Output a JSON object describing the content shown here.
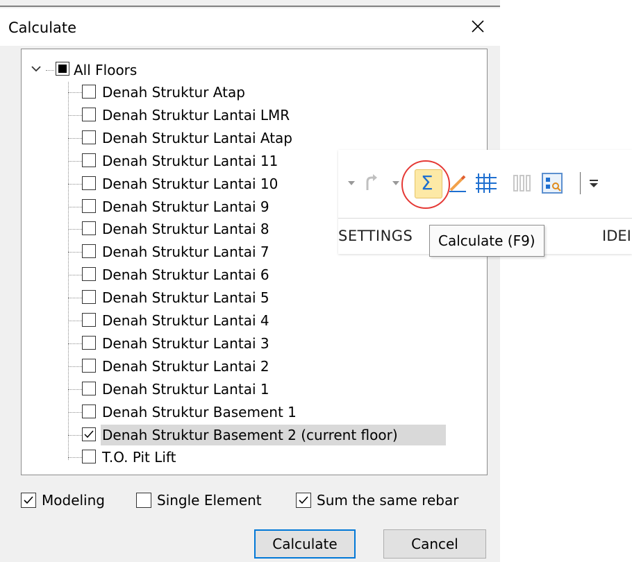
{
  "dialog": {
    "title": "Calculate",
    "close_icon": "close-icon"
  },
  "tree": {
    "root_label": "All Floors",
    "items": [
      {
        "label": "Denah Struktur Atap",
        "checked": false
      },
      {
        "label": "Denah Struktur Lantai LMR",
        "checked": false
      },
      {
        "label": "Denah Struktur Lantai Atap",
        "checked": false
      },
      {
        "label": "Denah Struktur Lantai 11",
        "checked": false
      },
      {
        "label": "Denah Struktur Lantai 10",
        "checked": false
      },
      {
        "label": "Denah Struktur Lantai 9",
        "checked": false
      },
      {
        "label": "Denah Struktur Lantai 8",
        "checked": false
      },
      {
        "label": "Denah Struktur Lantai 7",
        "checked": false
      },
      {
        "label": "Denah Struktur Lantai 6",
        "checked": false
      },
      {
        "label": "Denah Struktur Lantai 5",
        "checked": false
      },
      {
        "label": "Denah Struktur Lantai 4",
        "checked": false
      },
      {
        "label": "Denah Struktur Lantai 3",
        "checked": false
      },
      {
        "label": "Denah Struktur Lantai 2",
        "checked": false
      },
      {
        "label": "Denah Struktur Lantai 1",
        "checked": false
      },
      {
        "label": "Denah Struktur Basement 1",
        "checked": false
      },
      {
        "label": "Denah Struktur Basement 2 (current floor)",
        "checked": true,
        "highlighted": true
      },
      {
        "label": "T.O. Pit Lift",
        "checked": false
      }
    ]
  },
  "options": {
    "modeling": {
      "label": "Modeling",
      "checked": true
    },
    "single_element": {
      "label": "Single Element",
      "checked": false
    },
    "sum_same_rebar": {
      "label": "Sum the same rebar",
      "checked": true
    }
  },
  "buttons": {
    "calculate": "Calculate",
    "cancel": "Cancel"
  },
  "toolbar": {
    "tab_left": "SETTINGS",
    "tab_right": "IDEI",
    "tooltip": "Calculate (F9)",
    "highlight_color": "#e53935"
  }
}
